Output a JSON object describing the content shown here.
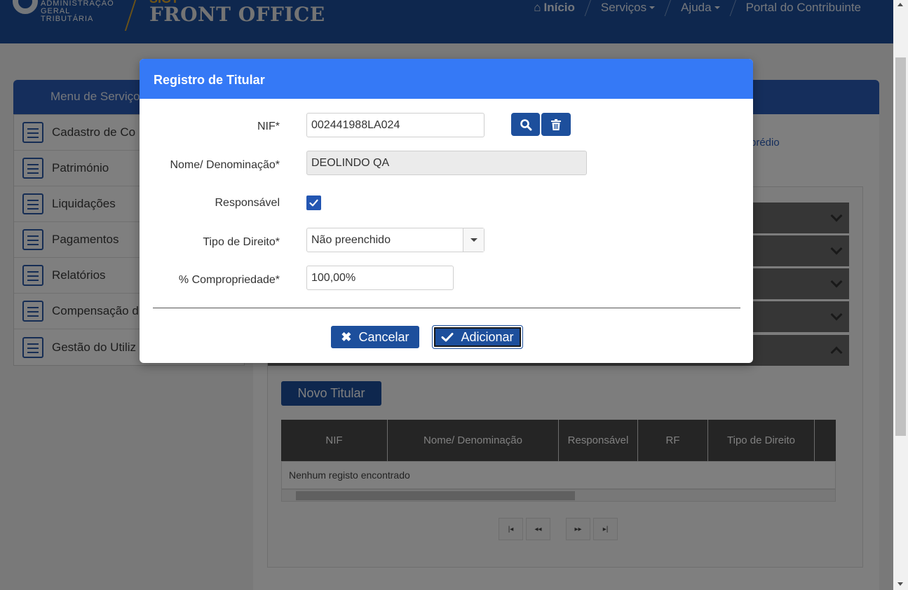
{
  "header": {
    "logo_lines": [
      "ADMINISTRAÇÃO",
      "GERAL",
      "TRIBUTÁRIA"
    ],
    "app_subtitle": "SIGT",
    "app_title": "FRONT OFFICE",
    "nav": {
      "home": "Início",
      "services": "Serviços",
      "help": "Ajuda",
      "portal": "Portal do Contribuinte"
    }
  },
  "sidebar": {
    "title": "Menu de Serviço",
    "items": [
      {
        "label": "Cadastro de Co",
        "icon": "form-icon"
      },
      {
        "label": "Património",
        "icon": "house-icon"
      },
      {
        "label": "Liquidações",
        "icon": "edit-document-icon"
      },
      {
        "label": "Pagamentos",
        "icon": "payment-form-icon"
      },
      {
        "label": "Relatórios",
        "icon": "report-icon"
      },
      {
        "label": "Compensação d",
        "icon": "document-icon"
      },
      {
        "label": "Gestão do Utiliz",
        "icon": "user-management-icon"
      }
    ]
  },
  "main": {
    "predio_link": "prédio",
    "new_holder_button": "Novo Titular",
    "table": {
      "columns": [
        "NIF",
        "Nome/ Denominação",
        "Responsável",
        "RF",
        "Tipo de Direito"
      ],
      "empty_message": "Nenhum registo encontrado"
    },
    "pager": [
      "first",
      "prev",
      "next",
      "last"
    ]
  },
  "modal": {
    "title": "Registro de Titular",
    "fields": {
      "nif": {
        "label": "NIF*",
        "value": "002441988LA024"
      },
      "name": {
        "label": "Nome/ Denominação*",
        "value": "DEOLINDO QA"
      },
      "responsible": {
        "label": "Responsável",
        "checked": true
      },
      "right_type": {
        "label": "Tipo de Direito*",
        "value": "Não preenchido"
      },
      "ownership": {
        "label": "% Compropriedade*",
        "value": "100,00%"
      }
    },
    "buttons": {
      "cancel": "Cancelar",
      "add": "Adicionar"
    }
  },
  "colors": {
    "modal_header": "#3579f6",
    "primary_button": "#1d4f9c",
    "topbar": "#1d4f9c",
    "accent_gold": "#e3a82c"
  }
}
